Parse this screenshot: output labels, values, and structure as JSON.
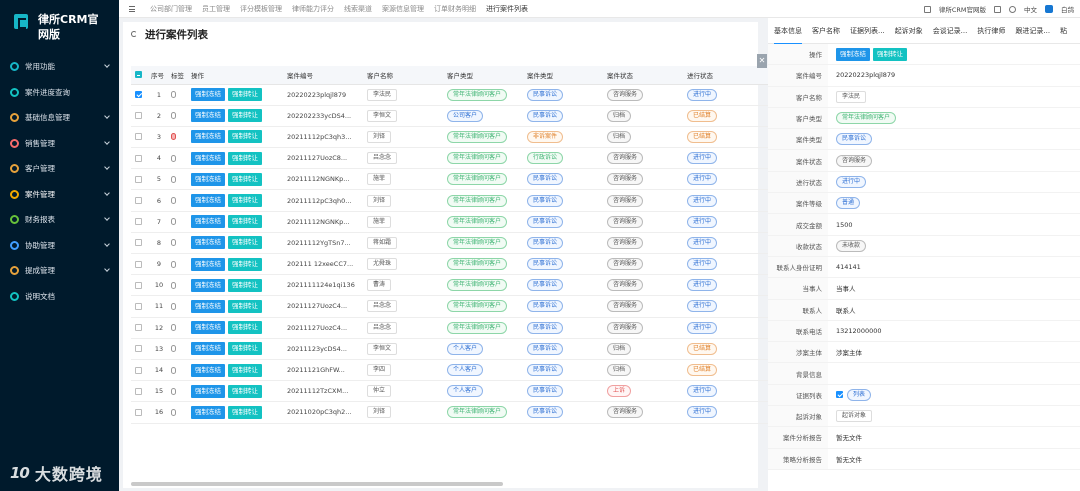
{
  "app": {
    "title_line1": "律所CRM官",
    "title_line2": "网版"
  },
  "sidebar": {
    "items": [
      {
        "label": "常用功能",
        "color": "#17b6c7"
      },
      {
        "label": "案件进度查询",
        "color": "#13c2c2"
      },
      {
        "label": "基础信息管理",
        "color": "#e6a23c"
      },
      {
        "label": "销售管理",
        "color": "#f56c6c"
      },
      {
        "label": "客户管理",
        "color": "#e6a23c"
      },
      {
        "label": "案件管理",
        "color": "#f2a900"
      },
      {
        "label": "财务报表",
        "color": "#67c23a"
      },
      {
        "label": "协助管理",
        "color": "#409eff"
      },
      {
        "label": "提成管理",
        "color": "#e6a23c"
      },
      {
        "label": "说明文档",
        "color": "#13c2c2"
      }
    ]
  },
  "watermark": {
    "logo": "10",
    "text": "大数跨境"
  },
  "topbar": {
    "tabs": [
      "公司部门管理",
      "员工管理",
      "评分模板管理",
      "律师能力评分",
      "线索渠道",
      "案源信息管理",
      "订单财务明细",
      "进行案件列表"
    ],
    "brand": "律所CRM官网版",
    "lang": "中文",
    "user": "白鸽"
  },
  "page": {
    "title": "进行案件列表"
  },
  "table": {
    "headers": [
      "序号",
      "标签",
      "操作",
      "案件编号",
      "客户名称",
      "客户类型",
      "案件类型",
      "案件状态",
      "进行状态"
    ],
    "btn1": "强制冻结",
    "btn2": "强制转让",
    "rows": [
      {
        "no": "1",
        "id": "20220223plqjl879",
        "client": "李法民",
        "ctype": "常年法律顾问客户",
        "ctc": "green",
        "case": "民事诉讼",
        "kc": "blue",
        "status": "咨询服务",
        "sc": "gray",
        "prog": "进行中",
        "pc": "blue",
        "checked": true
      },
      {
        "no": "2",
        "id": "202202233ycDS4...",
        "client": "李恒文",
        "ctype": "公司客户",
        "ctc": "blue",
        "case": "民事诉讼",
        "kc": "blue",
        "status": "归档",
        "sc": "gray",
        "prog": "已结算",
        "pc": "orange"
      },
      {
        "no": "3",
        "id": "20211112pC3qh3...",
        "client": "刘铎",
        "ctype": "常年法律顾问客户",
        "ctc": "green",
        "case": "非诉案件",
        "kc": "orange",
        "status": "归档",
        "sc": "gray",
        "prog": "已结算",
        "pc": "orange",
        "redclip": true
      },
      {
        "no": "4",
        "id": "20211127UozC8...",
        "client": "吕念念",
        "ctype": "常年法律顾问客户",
        "ctc": "green",
        "case": "行政诉讼",
        "kc": "green",
        "status": "咨询服务",
        "sc": "gray",
        "prog": "进行中",
        "pc": "blue"
      },
      {
        "no": "5",
        "id": "20211112NGNKp...",
        "client": "施菲",
        "ctype": "常年法律顾问客户",
        "ctc": "green",
        "case": "民事诉讼",
        "kc": "blue",
        "status": "咨询服务",
        "sc": "gray",
        "prog": "进行中",
        "pc": "blue"
      },
      {
        "no": "6",
        "id": "20211112pC3qh0...",
        "client": "刘铎",
        "ctype": "常年法律顾问客户",
        "ctc": "green",
        "case": "民事诉讼",
        "kc": "blue",
        "status": "咨询服务",
        "sc": "gray",
        "prog": "进行中",
        "pc": "blue"
      },
      {
        "no": "7",
        "id": "20211112NGNKp...",
        "client": "施菲",
        "ctype": "常年法律顾问客户",
        "ctc": "green",
        "case": "民事诉讼",
        "kc": "blue",
        "status": "咨询服务",
        "sc": "gray",
        "prog": "进行中",
        "pc": "blue"
      },
      {
        "no": "8",
        "id": "20211112YgTSn7...",
        "client": "蒋如霜",
        "ctype": "常年法律顾问客户",
        "ctc": "green",
        "case": "民事诉讼",
        "kc": "blue",
        "status": "咨询服务",
        "sc": "gray",
        "prog": "进行中",
        "pc": "blue"
      },
      {
        "no": "9",
        "id": "202111 12xeeCC7...",
        "client": "尤舜珠",
        "ctype": "常年法律顾问客户",
        "ctc": "green",
        "case": "民事诉讼",
        "kc": "blue",
        "status": "咨询服务",
        "sc": "gray",
        "prog": "进行中",
        "pc": "blue"
      },
      {
        "no": "10",
        "id": "2021111124e1qi136",
        "client": "曹涛",
        "ctype": "常年法律顾问客户",
        "ctc": "green",
        "case": "民事诉讼",
        "kc": "blue",
        "status": "咨询服务",
        "sc": "gray",
        "prog": "进行中",
        "pc": "blue"
      },
      {
        "no": "11",
        "id": "20211127UozC4...",
        "client": "吕念念",
        "ctype": "常年法律顾问客户",
        "ctc": "green",
        "case": "民事诉讼",
        "kc": "blue",
        "status": "咨询服务",
        "sc": "gray",
        "prog": "进行中",
        "pc": "blue"
      },
      {
        "no": "12",
        "id": "20211127UozC4...",
        "client": "吕念念",
        "ctype": "常年法律顾问客户",
        "ctc": "green",
        "case": "民事诉讼",
        "kc": "blue",
        "status": "咨询服务",
        "sc": "gray",
        "prog": "进行中",
        "pc": "blue"
      },
      {
        "no": "13",
        "id": "20211123ycDS4...",
        "client": "李恒文",
        "ctype": "个人客户",
        "ctc": "blue",
        "case": "民事诉讼",
        "kc": "blue",
        "status": "归档",
        "sc": "gray",
        "prog": "已结算",
        "pc": "orange"
      },
      {
        "no": "14",
        "id": "20211121GhFW...",
        "client": "李四",
        "ctype": "个人客户",
        "ctc": "blue",
        "case": "民事诉讼",
        "kc": "blue",
        "status": "归档",
        "sc": "gray",
        "prog": "已结算",
        "pc": "orange"
      },
      {
        "no": "15",
        "id": "20211112TzCXM...",
        "client": "仲立",
        "ctype": "个人客户",
        "ctc": "blue",
        "case": "民事诉讼",
        "kc": "blue",
        "status": "上诉",
        "sc": "red",
        "prog": "进行中",
        "pc": "blue"
      },
      {
        "no": "16",
        "id": "20211020pC3qh2...",
        "client": "刘铎",
        "ctype": "常年法律顾问客户",
        "ctc": "green",
        "case": "民事诉讼",
        "kc": "blue",
        "status": "咨询服务",
        "sc": "gray",
        "prog": "进行中",
        "pc": "blue"
      }
    ]
  },
  "detail": {
    "tabs": [
      "基本信息",
      "客户名称",
      "证据列表...",
      "起诉对象",
      "会谈记录...",
      "执行律师",
      "跟进记录...",
      "粘"
    ],
    "rows": [
      {
        "label": "操作",
        "type": "buttons"
      },
      {
        "label": "案件编号",
        "value": "20220223plqjl879"
      },
      {
        "label": "客户名称",
        "value": "李法民",
        "type": "person"
      },
      {
        "label": "客户类型",
        "value": "常年法律顾问客户",
        "type": "tag",
        "c": "green"
      },
      {
        "label": "案件类型",
        "value": "民事诉讼",
        "type": "tag",
        "c": "blue"
      },
      {
        "label": "案件状态",
        "value": "咨询服务",
        "type": "tag",
        "c": "gray"
      },
      {
        "label": "进行状态",
        "value": "进行中",
        "type": "tag",
        "c": "blue"
      },
      {
        "label": "案件等级",
        "value": "普通",
        "type": "tag",
        "c": "blue"
      },
      {
        "label": "成交金额",
        "value": "1500"
      },
      {
        "label": "收款状态",
        "value": "未收款",
        "type": "tag",
        "c": "gray"
      },
      {
        "label": "联系人身份证明",
        "value": "414141"
      },
      {
        "label": "当事人",
        "value": "当事人"
      },
      {
        "label": "联系人",
        "value": "联系人"
      },
      {
        "label": "联系电话",
        "value": "13212000000"
      },
      {
        "label": "涉案主体",
        "value": "涉案主体"
      },
      {
        "label": "背景信息",
        "value": ""
      },
      {
        "label": "证据列表",
        "value": "列表",
        "type": "check"
      },
      {
        "label": "起诉对象",
        "value": "起诉对象",
        "type": "person"
      },
      {
        "label": "案件分析报告",
        "value": "暂无文件"
      },
      {
        "label": "策略分析报告",
        "value": "暂无文件"
      }
    ]
  }
}
